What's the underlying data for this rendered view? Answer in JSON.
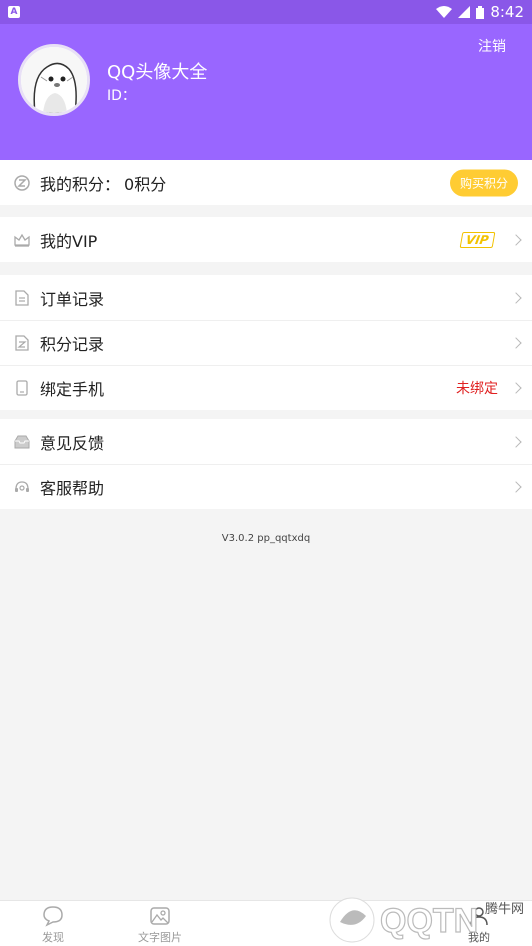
{
  "status_bar": {
    "time": "8:42"
  },
  "header": {
    "username": "QQ头像大全",
    "id_label": "ID：",
    "logout_label": "注销"
  },
  "points": {
    "label": "我的积分：",
    "value": "0积分",
    "buy_label": "购买积分"
  },
  "vip": {
    "label": "我的VIP",
    "badge": "VIP"
  },
  "menu": {
    "orders": "订单记录",
    "points_log": "积分记录",
    "bind_phone": "绑定手机",
    "bind_status": "未绑定",
    "feedback": "意见反馈",
    "support": "客服帮助"
  },
  "version": "V3.0.2 pp_qqtxdq",
  "tabs": [
    {
      "label": "发现",
      "icon": "chat-bubble-icon"
    },
    {
      "label": "文字图片",
      "icon": "image-icon"
    },
    {
      "label": "我的",
      "icon": "user-icon"
    }
  ],
  "watermark": {
    "text": "腾牛网"
  },
  "colors": {
    "header": "#9966ff",
    "buy_button": "#ffcc33",
    "vip": "#f2c200",
    "unbound": "#e02020"
  }
}
